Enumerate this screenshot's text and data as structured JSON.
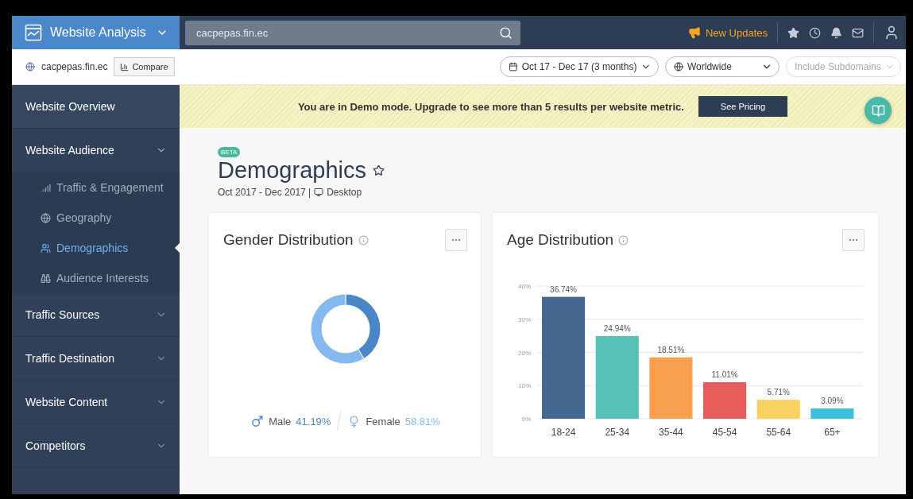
{
  "header": {
    "product": "Website Analysis",
    "search": {
      "value": "cacpepas.fin.ec"
    },
    "updates": "New Updates"
  },
  "subbar": {
    "site": "cacpepas.fin.ec",
    "compare": "Compare",
    "date_range": "Oct 17 - Dec 17 (3 months)",
    "country": "Worldwide",
    "subdomains": {
      "placeholder": "Include Subdomains",
      "disabled": true
    }
  },
  "sidebar": {
    "items": [
      {
        "label": "Website Overview",
        "kind": "link"
      },
      {
        "label": "Website Audience",
        "kind": "group",
        "expanded": true,
        "children": [
          {
            "label": "Traffic & Engagement",
            "selected": false
          },
          {
            "label": "Geography",
            "selected": false
          },
          {
            "label": "Demographics",
            "selected": true
          },
          {
            "label": "Audience Interests",
            "selected": false
          }
        ]
      },
      {
        "label": "Traffic Sources",
        "kind": "group",
        "expanded": false
      },
      {
        "label": "Traffic Destination",
        "kind": "group",
        "expanded": false
      },
      {
        "label": "Website Content",
        "kind": "group",
        "expanded": false
      },
      {
        "label": "Competitors",
        "kind": "group",
        "expanded": false
      }
    ]
  },
  "banner": {
    "message": "You are in Demo mode. Upgrade to see more than 5 results per website metric.",
    "button": "See Pricing"
  },
  "page": {
    "badge": "BETA",
    "title": "Demographics",
    "period": "Oct 2017 - Dec 2017 |",
    "device": "Desktop"
  },
  "gender": {
    "title": "Gender Distribution",
    "chart_data": {
      "type": "donut",
      "categories": [
        "Male",
        "Female"
      ],
      "values": [
        41.19,
        58.81
      ]
    },
    "legend": [
      {
        "value": "41.19%",
        "color": "#4a87c8"
      },
      {
        "value": "58.81%",
        "color": "#85b8ee"
      }
    ]
  },
  "age": {
    "title": "Age Distribution",
    "bars": [
      {
        "color": "#456890"
      },
      {
        "color": "#56c2b6"
      },
      {
        "color": "#f9a04f"
      },
      {
        "color": "#e85d5c"
      },
      {
        "color": "#f8d160"
      },
      {
        "color": "#3bc1dc"
      }
    ],
    "chart_data": {
      "type": "bar",
      "grid": true,
      "categories": [
        "18-24",
        "25-34",
        "35-44",
        "45-54",
        "55-64",
        "65+"
      ],
      "values": [
        36.74,
        24.94,
        18.51,
        11.01,
        5.71,
        3.09
      ],
      "ylim": [
        0,
        40
      ],
      "yticks": [
        {
          "value": 0,
          "label": "0%"
        },
        {
          "value": 10,
          "label": "10%"
        },
        {
          "value": 20,
          "label": "20%"
        },
        {
          "value": 30,
          "label": "30%"
        },
        {
          "value": 40,
          "label": "40%"
        }
      ],
      "value_labels": [
        "36.74%",
        "24.94%",
        "18.51%",
        "11.01%",
        "5.71%",
        "3.09%"
      ]
    }
  }
}
